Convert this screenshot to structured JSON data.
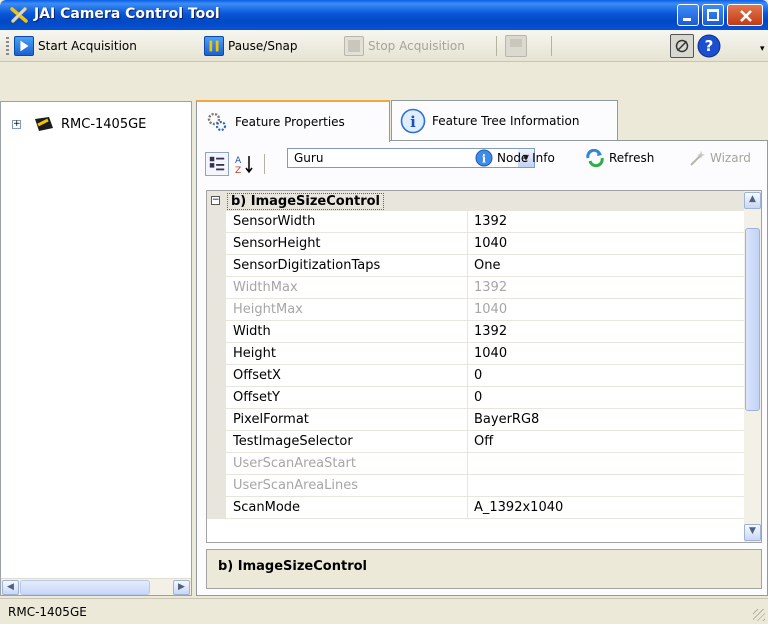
{
  "window": {
    "title": "JAI Camera Control Tool",
    "controls": [
      "minimize",
      "maximize",
      "close"
    ]
  },
  "toolbar": {
    "start_acquisition": "Start Acquisition",
    "pause_snap": "Pause/Snap",
    "stop_acquisition": "Stop Acquisition"
  },
  "tree": {
    "camera_node": "RMC-1405GE"
  },
  "tabs": {
    "feature_properties": "Feature Properties",
    "feature_tree_info": "Feature Tree Information"
  },
  "property_toolbar": {
    "visibility_level": "Guru",
    "node_info": "Node Info",
    "refresh": "Refresh",
    "wizard": "Wizard"
  },
  "grid": {
    "category": "b) ImageSizeControl",
    "rows": [
      {
        "name": "SensorWidth",
        "value": "1392",
        "readonly": false
      },
      {
        "name": "SensorHeight",
        "value": "1040",
        "readonly": false
      },
      {
        "name": "SensorDigitizationTaps",
        "value": "One",
        "readonly": false
      },
      {
        "name": "WidthMax",
        "value": "1392",
        "readonly": true
      },
      {
        "name": "HeightMax",
        "value": "1040",
        "readonly": true
      },
      {
        "name": "Width",
        "value": "1392",
        "readonly": false
      },
      {
        "name": "Height",
        "value": "1040",
        "readonly": false
      },
      {
        "name": "OffsetX",
        "value": "0",
        "readonly": false
      },
      {
        "name": "OffsetY",
        "value": "0",
        "readonly": false
      },
      {
        "name": "PixelFormat",
        "value": "BayerRG8",
        "readonly": false
      },
      {
        "name": "TestImageSelector",
        "value": "Off",
        "readonly": false
      },
      {
        "name": "UserScanAreaStart",
        "value": "",
        "readonly": true
      },
      {
        "name": "UserScanAreaLines",
        "value": "",
        "readonly": true
      },
      {
        "name": "ScanMode",
        "value": "A_1392x1040",
        "readonly": false
      }
    ]
  },
  "description": {
    "title": "b) ImageSizeControl"
  },
  "status": {
    "text": "RMC-1405GE"
  }
}
